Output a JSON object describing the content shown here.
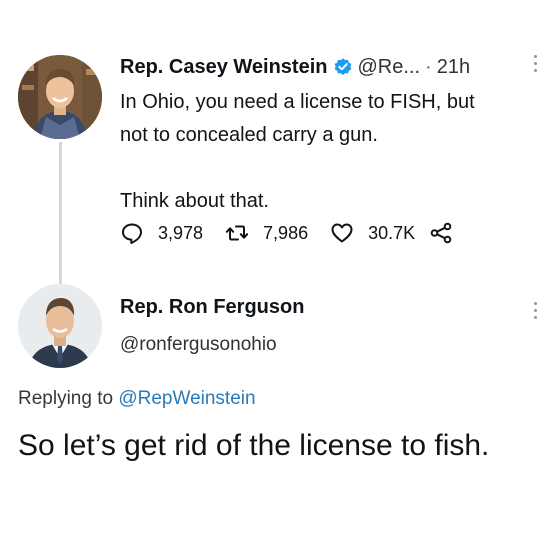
{
  "tweet": {
    "author_name": "Rep. Casey Weinstein",
    "handle": "@Re...",
    "separator": "·",
    "time": "21h",
    "text_lines": [
      "In Ohio, you need a license to FISH, but",
      "not to concealed carry a gun."
    ],
    "text_line_2": "Think about that.",
    "actions": {
      "replies": "3,978",
      "retweets": "7,986",
      "likes": "30.7K"
    }
  },
  "reply": {
    "author_name": "Rep. Ron Ferguson",
    "handle": "@ronfergusonohio",
    "replying_prefix": "Replying to",
    "replying_to": "@RepWeinstein",
    "text": "So let’s get rid of the license to fish."
  },
  "colors": {
    "verified_badge": "#1d9bf0",
    "mention": "#2a7ab8",
    "thread_line": "#cfd9de"
  }
}
